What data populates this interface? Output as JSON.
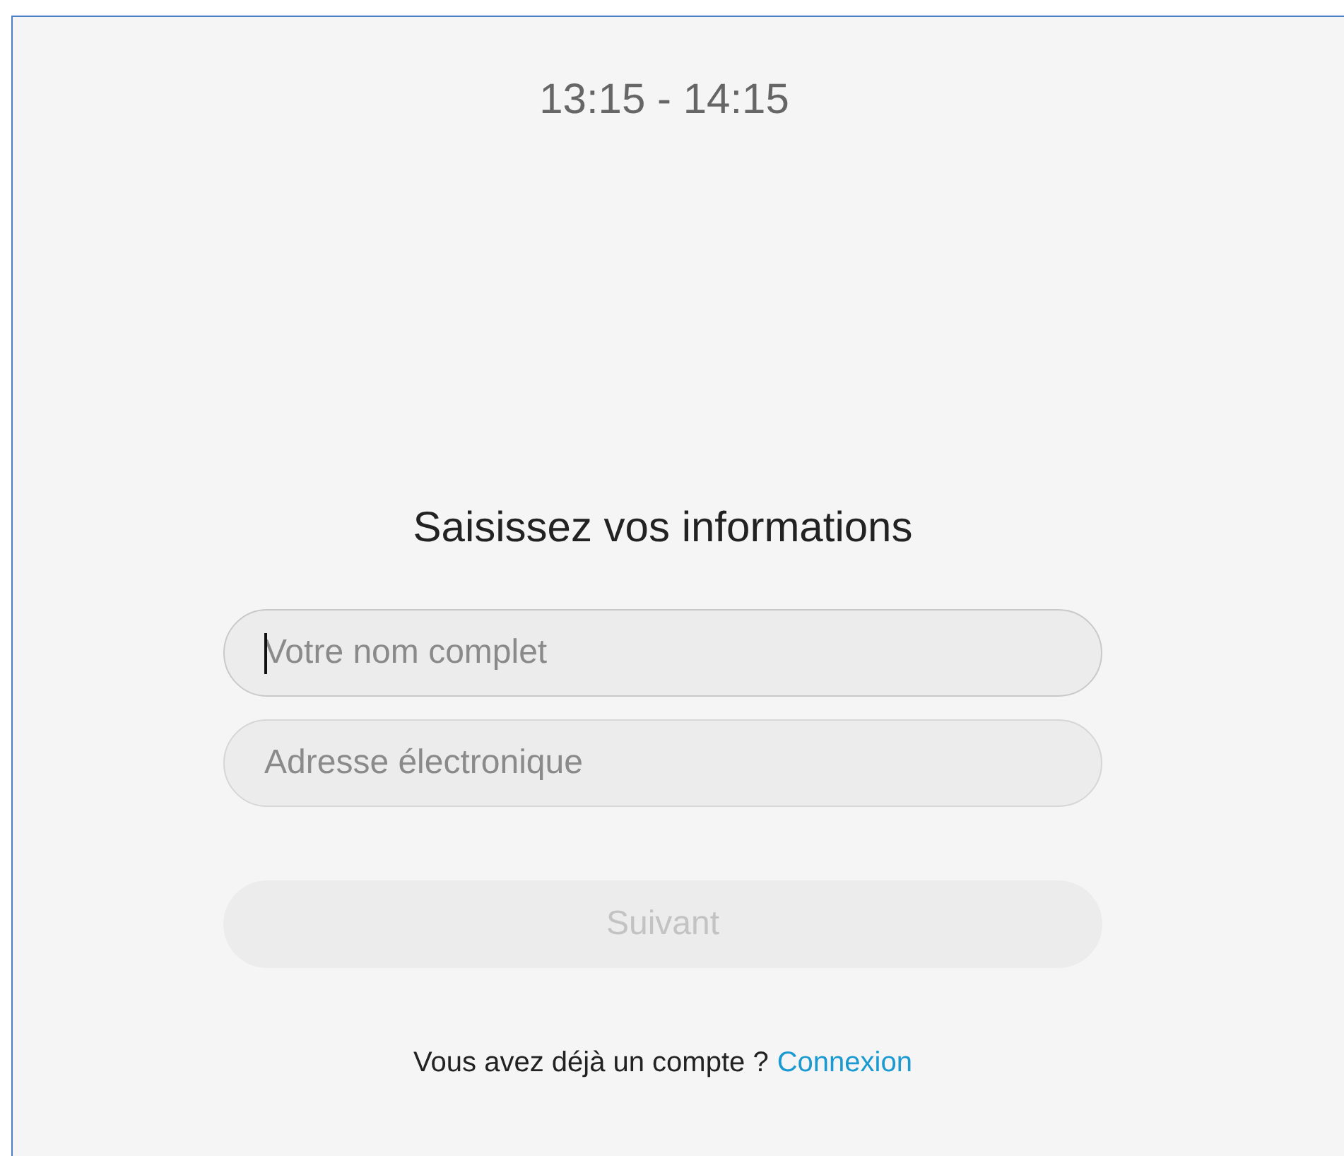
{
  "time_range": "13:15 - 14:15",
  "heading": "Saisissez vos informations",
  "fields": [
    {
      "placeholder": "Votre nom complet",
      "focused": true
    },
    {
      "placeholder": "Adresse électronique",
      "focused": false
    }
  ],
  "next_button": {
    "label": "Suivant",
    "disabled": true
  },
  "footer": {
    "text": "Vous avez déjà un compte ?",
    "link": "Connexion"
  }
}
